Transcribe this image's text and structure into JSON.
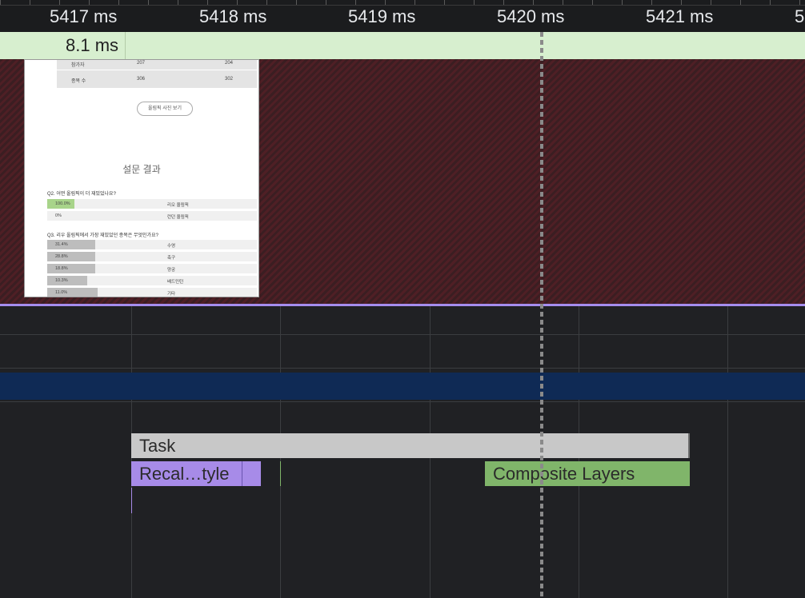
{
  "ruler": {
    "ticks": [
      "5417 ms",
      "5418 ms",
      "5419 ms",
      "5420 ms",
      "5421 ms",
      "5"
    ]
  },
  "frames": {
    "duration_label": "8.1 ms"
  },
  "screenshot": {
    "table_rows": [
      {
        "label": "참가자",
        "a": "207",
        "b": "204"
      },
      {
        "label": "종목 수",
        "a": "306",
        "b": "302"
      }
    ],
    "button_label": "올림픽 사진 보기",
    "survey_title": "설문 결과",
    "q2": {
      "question": "Q2. 어떤 올림픽이 더 재밌었나요?",
      "rows": [
        {
          "pct": "100.0%",
          "label": "리오 올림픽",
          "fill": 0.13,
          "color": "#a8d48a"
        },
        {
          "pct": "0%",
          "label": "런던 올림픽",
          "fill": 0.0,
          "color": "#bdbdbd"
        }
      ]
    },
    "q3": {
      "question": "Q3. 리우 올림픽에서 가장 재밌었던 종목은 무엇인가요?",
      "rows": [
        {
          "pct": "31.4%",
          "label": "수영",
          "fill": 0.23
        },
        {
          "pct": "28.8%",
          "label": "축구",
          "fill": 0.23
        },
        {
          "pct": "18.8%",
          "label": "양궁",
          "fill": 0.23
        },
        {
          "pct": "10.3%",
          "label": "배드민턴",
          "fill": 0.19
        },
        {
          "pct": "11.0%",
          "label": "기타",
          "fill": 0.24
        }
      ]
    }
  },
  "main_thread": {
    "task_label": "Task",
    "recalc_label": "Recal…tyle",
    "composite_label": "Composite Layers"
  }
}
